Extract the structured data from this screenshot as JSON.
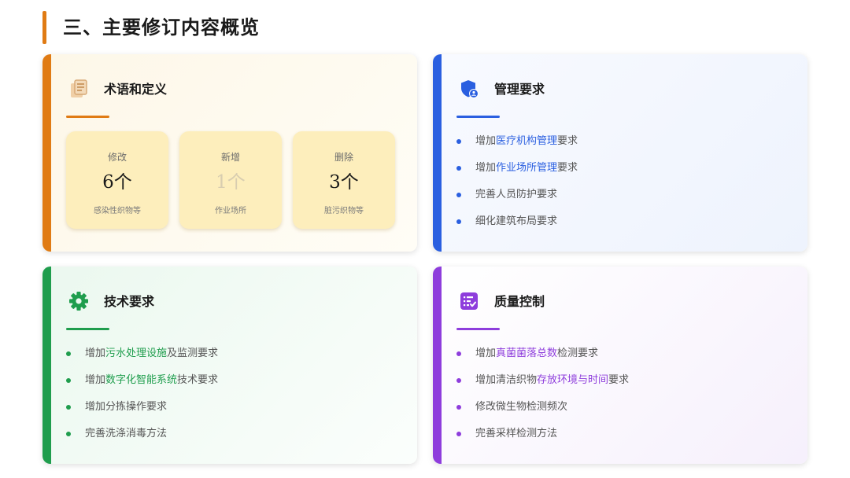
{
  "page": {
    "title": "三、主要修订内容概览"
  },
  "colors": {
    "orange": "#e07b14",
    "blue": "#2a5fe0",
    "green": "#1f9d4d",
    "purple": "#8e3ddc"
  },
  "terms": {
    "title": "术语和定义",
    "icon": "document-copy-icon",
    "stats": [
      {
        "label": "修改",
        "value": "6个",
        "note": "感染性织物等"
      },
      {
        "label": "新增",
        "value": "1个",
        "note": "作业场所"
      },
      {
        "label": "删除",
        "value": "3个",
        "note": "脏污织物等"
      }
    ]
  },
  "management": {
    "title": "管理要求",
    "icon": "shield-user-icon",
    "items": [
      {
        "pre": "增加",
        "hl": "医疗机构管理",
        "post": "要求"
      },
      {
        "pre": "增加",
        "hl": "作业场所管理",
        "post": "要求"
      },
      {
        "pre": "完善人员防护要求",
        "hl": "",
        "post": ""
      },
      {
        "pre": "细化建筑布局要求",
        "hl": "",
        "post": ""
      }
    ]
  },
  "technical": {
    "title": "技术要求",
    "icon": "gear-icon",
    "items": [
      {
        "pre": "增加",
        "hl": "污水处理设施",
        "post": "及监测要求"
      },
      {
        "pre": "增加",
        "hl": "数字化智能系统",
        "post": "技术要求"
      },
      {
        "pre": "增加分拣操作要求",
        "hl": "",
        "post": ""
      },
      {
        "pre": "完善洗涤消毒方法",
        "hl": "",
        "post": ""
      }
    ]
  },
  "quality": {
    "title": "质量控制",
    "icon": "checklist-icon",
    "items": [
      {
        "pre": "增加",
        "hl": "真菌菌落总数",
        "post": "检测要求"
      },
      {
        "pre": "增加清洁织物",
        "hl": "存放环境与时间",
        "post": "要求"
      },
      {
        "pre": "修改微生物检测频次",
        "hl": "",
        "post": ""
      },
      {
        "pre": "完善采样检测方法",
        "hl": "",
        "post": ""
      }
    ]
  }
}
